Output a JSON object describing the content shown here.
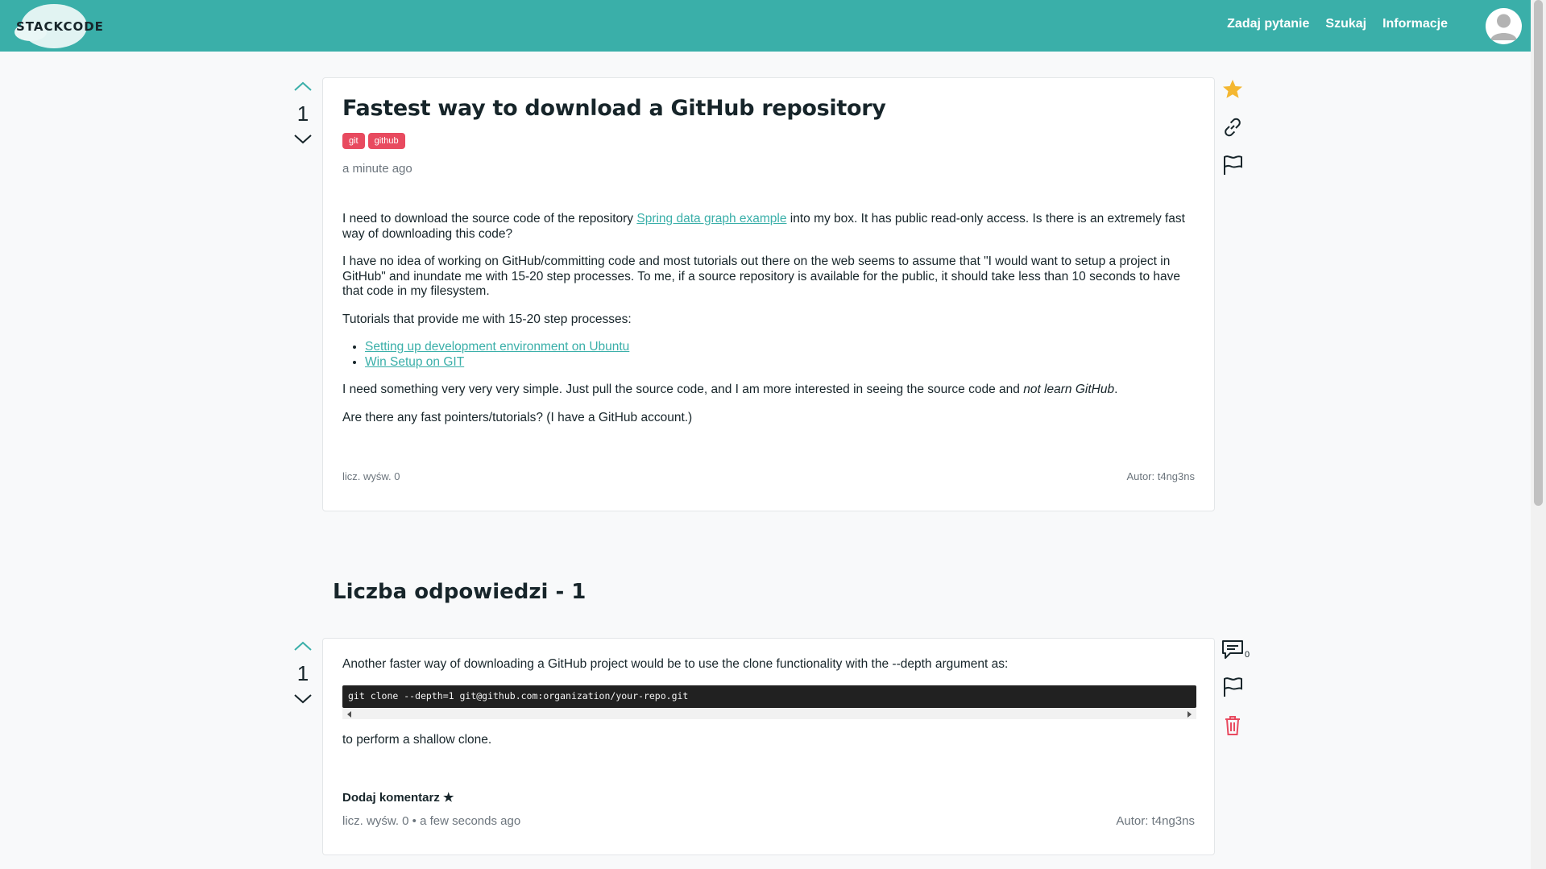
{
  "nav": {
    "logo": "STACKCODE",
    "links": [
      "Zadaj pytanie",
      "Szukaj",
      "Informacje"
    ]
  },
  "question": {
    "votes": "1",
    "title": "Fastest way to download a GitHub repository",
    "tags": [
      "git",
      "github"
    ],
    "time": "a minute ago",
    "p1_before": "I need to download the source code of the repository ",
    "p1_link": "Spring data graph example",
    "p1_after": " into my box. It has public read-only access. Is there is an extremely fast way of downloading this code?",
    "p2": "I have no idea of working on GitHub/committing code and most tutorials out there on the web seems to assume that \"I would want to setup a project in GitHub\" and inundate me with 15-20 step processes. To me, if a source repository is available for the public, it should take less than 10 seconds to have that code in my filesystem.",
    "p3": "Tutorials that provide me with 15-20 step processes:",
    "links": [
      "Setting up development environment on Ubuntu",
      "Win Setup on GIT"
    ],
    "p4_before": "I need something very very very simple. Just pull the source code, and I am more interested in seeing the source code and ",
    "p4_em": "not learn GitHub",
    "p4_after": ".",
    "p5": "Are there any fast pointers/tutorials? (I have a GitHub account.)",
    "views": "licz. wyśw. 0",
    "author": "Autor: t4ng3ns"
  },
  "answers_heading": "Liczba odpowiedzi - 1",
  "answer": {
    "votes": "1",
    "intro": "Another faster way of downloading a GitHub project would be to use the clone functionality with the --depth argument as:",
    "code": "git clone --depth=1 git@github.com:organization/your-repo.git",
    "outro": "to perform a shallow clone.",
    "add_comment": "Dodaj komentarz ★",
    "meta": "licz. wyśw. 0 • a few seconds ago",
    "author": "Autor: t4ng3ns",
    "comment_count": "0"
  },
  "colors": {
    "nav": "#3aafa9",
    "tag": "#e84a5f",
    "star": "#f4b731",
    "delete": "#e84a5f"
  }
}
